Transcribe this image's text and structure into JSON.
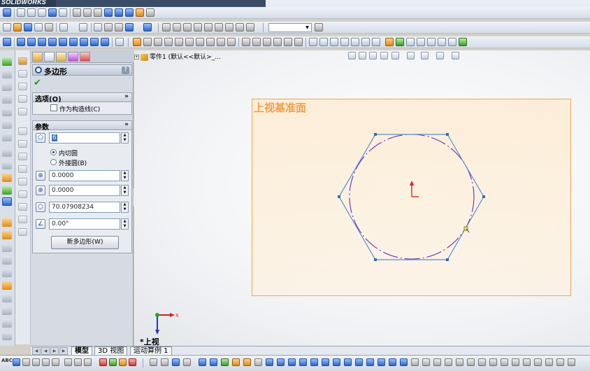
{
  "app": {
    "logo_text": "SOLIDWORKS"
  },
  "feature_tree": {
    "item": "零件1 (默认<<默认>_..."
  },
  "property_manager": {
    "title": "多边形",
    "options": {
      "header": "选项(O)",
      "construction_label": "作为构造线(C)",
      "construction_checked": false
    },
    "params": {
      "header": "参数",
      "sides": "6",
      "inscribed_label": "内切圆",
      "circumscribed_label": "外接圆(B)",
      "inscribed_selected": true,
      "center_x": "0.0000",
      "center_y": "0.0000",
      "diameter": "70.07908234",
      "angle": "0.00°",
      "new_polygon_button": "新多边形(W)"
    }
  },
  "viewport": {
    "plane_label": "上视基准面",
    "view_label": "*上视"
  },
  "bottom_tabs": [
    {
      "label": "模型",
      "active": true
    },
    {
      "label": "3D 视图",
      "active": false
    },
    {
      "label": "运动算例 1",
      "active": false
    }
  ],
  "statusbar": {
    "abc_label": "ABC"
  },
  "colors": {
    "plane_border": "#f2a74b",
    "plane_label": "#f0a04a",
    "sketch_line": "#4f8fdc",
    "construction_circle": "#6a2fb0",
    "origin_red": "#e0201c"
  }
}
